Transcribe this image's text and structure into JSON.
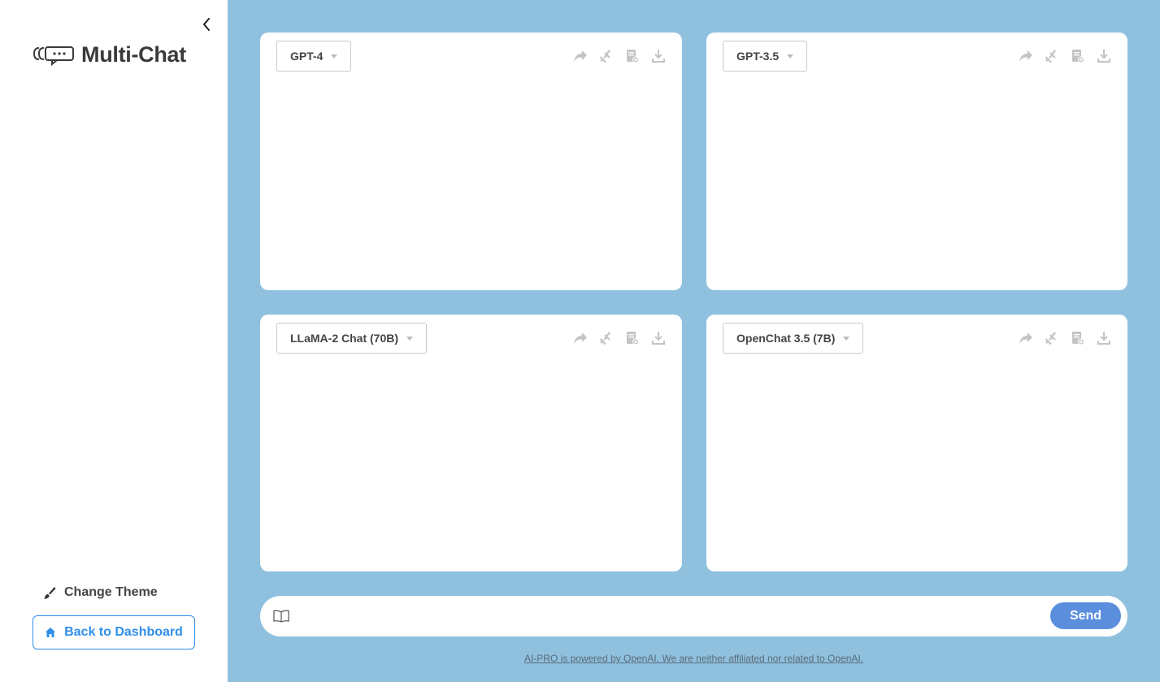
{
  "sidebar": {
    "logo_text": "Multi-Chat",
    "change_theme_label": "Change Theme",
    "back_label": "Back to Dashboard"
  },
  "panels": [
    {
      "model": "GPT-4"
    },
    {
      "model": "GPT-3.5"
    },
    {
      "model": "LLaMA-2 Chat (70B)"
    },
    {
      "model": "OpenChat 3.5 (7B)"
    }
  ],
  "toolbar_icons": [
    "share-icon",
    "clear-icon",
    "export-icon",
    "download-icon"
  ],
  "input": {
    "placeholder": "",
    "send_label": "Send"
  },
  "footer_text": "AI-PRO is powered by OpenAI. We are neither affiliated nor related to OpenAI.",
  "colors": {
    "main_bg": "#8fc1df",
    "accent": "#2f8fe8",
    "send_button": "#5b8fde",
    "icon_gray": "#c4c4c4"
  }
}
